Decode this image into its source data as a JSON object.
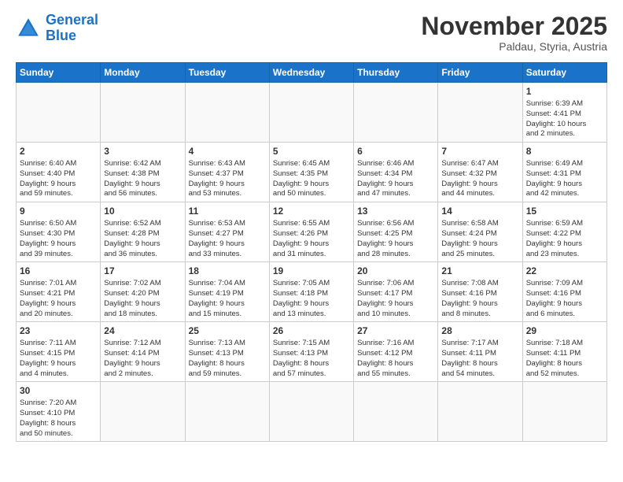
{
  "logo": {
    "line1": "General",
    "line2": "Blue"
  },
  "title": "November 2025",
  "subtitle": "Paldau, Styria, Austria",
  "weekdays": [
    "Sunday",
    "Monday",
    "Tuesday",
    "Wednesday",
    "Thursday",
    "Friday",
    "Saturday"
  ],
  "weeks": [
    [
      {
        "day": "",
        "info": ""
      },
      {
        "day": "",
        "info": ""
      },
      {
        "day": "",
        "info": ""
      },
      {
        "day": "",
        "info": ""
      },
      {
        "day": "",
        "info": ""
      },
      {
        "day": "",
        "info": ""
      },
      {
        "day": "1",
        "info": "Sunrise: 6:39 AM\nSunset: 4:41 PM\nDaylight: 10 hours\nand 2 minutes."
      }
    ],
    [
      {
        "day": "2",
        "info": "Sunrise: 6:40 AM\nSunset: 4:40 PM\nDaylight: 9 hours\nand 59 minutes."
      },
      {
        "day": "3",
        "info": "Sunrise: 6:42 AM\nSunset: 4:38 PM\nDaylight: 9 hours\nand 56 minutes."
      },
      {
        "day": "4",
        "info": "Sunrise: 6:43 AM\nSunset: 4:37 PM\nDaylight: 9 hours\nand 53 minutes."
      },
      {
        "day": "5",
        "info": "Sunrise: 6:45 AM\nSunset: 4:35 PM\nDaylight: 9 hours\nand 50 minutes."
      },
      {
        "day": "6",
        "info": "Sunrise: 6:46 AM\nSunset: 4:34 PM\nDaylight: 9 hours\nand 47 minutes."
      },
      {
        "day": "7",
        "info": "Sunrise: 6:47 AM\nSunset: 4:32 PM\nDaylight: 9 hours\nand 44 minutes."
      },
      {
        "day": "8",
        "info": "Sunrise: 6:49 AM\nSunset: 4:31 PM\nDaylight: 9 hours\nand 42 minutes."
      }
    ],
    [
      {
        "day": "9",
        "info": "Sunrise: 6:50 AM\nSunset: 4:30 PM\nDaylight: 9 hours\nand 39 minutes."
      },
      {
        "day": "10",
        "info": "Sunrise: 6:52 AM\nSunset: 4:28 PM\nDaylight: 9 hours\nand 36 minutes."
      },
      {
        "day": "11",
        "info": "Sunrise: 6:53 AM\nSunset: 4:27 PM\nDaylight: 9 hours\nand 33 minutes."
      },
      {
        "day": "12",
        "info": "Sunrise: 6:55 AM\nSunset: 4:26 PM\nDaylight: 9 hours\nand 31 minutes."
      },
      {
        "day": "13",
        "info": "Sunrise: 6:56 AM\nSunset: 4:25 PM\nDaylight: 9 hours\nand 28 minutes."
      },
      {
        "day": "14",
        "info": "Sunrise: 6:58 AM\nSunset: 4:24 PM\nDaylight: 9 hours\nand 25 minutes."
      },
      {
        "day": "15",
        "info": "Sunrise: 6:59 AM\nSunset: 4:22 PM\nDaylight: 9 hours\nand 23 minutes."
      }
    ],
    [
      {
        "day": "16",
        "info": "Sunrise: 7:01 AM\nSunset: 4:21 PM\nDaylight: 9 hours\nand 20 minutes."
      },
      {
        "day": "17",
        "info": "Sunrise: 7:02 AM\nSunset: 4:20 PM\nDaylight: 9 hours\nand 18 minutes."
      },
      {
        "day": "18",
        "info": "Sunrise: 7:04 AM\nSunset: 4:19 PM\nDaylight: 9 hours\nand 15 minutes."
      },
      {
        "day": "19",
        "info": "Sunrise: 7:05 AM\nSunset: 4:18 PM\nDaylight: 9 hours\nand 13 minutes."
      },
      {
        "day": "20",
        "info": "Sunrise: 7:06 AM\nSunset: 4:17 PM\nDaylight: 9 hours\nand 10 minutes."
      },
      {
        "day": "21",
        "info": "Sunrise: 7:08 AM\nSunset: 4:16 PM\nDaylight: 9 hours\nand 8 minutes."
      },
      {
        "day": "22",
        "info": "Sunrise: 7:09 AM\nSunset: 4:16 PM\nDaylight: 9 hours\nand 6 minutes."
      }
    ],
    [
      {
        "day": "23",
        "info": "Sunrise: 7:11 AM\nSunset: 4:15 PM\nDaylight: 9 hours\nand 4 minutes."
      },
      {
        "day": "24",
        "info": "Sunrise: 7:12 AM\nSunset: 4:14 PM\nDaylight: 9 hours\nand 2 minutes."
      },
      {
        "day": "25",
        "info": "Sunrise: 7:13 AM\nSunset: 4:13 PM\nDaylight: 8 hours\nand 59 minutes."
      },
      {
        "day": "26",
        "info": "Sunrise: 7:15 AM\nSunset: 4:13 PM\nDaylight: 8 hours\nand 57 minutes."
      },
      {
        "day": "27",
        "info": "Sunrise: 7:16 AM\nSunset: 4:12 PM\nDaylight: 8 hours\nand 55 minutes."
      },
      {
        "day": "28",
        "info": "Sunrise: 7:17 AM\nSunset: 4:11 PM\nDaylight: 8 hours\nand 54 minutes."
      },
      {
        "day": "29",
        "info": "Sunrise: 7:18 AM\nSunset: 4:11 PM\nDaylight: 8 hours\nand 52 minutes."
      }
    ],
    [
      {
        "day": "30",
        "info": "Sunrise: 7:20 AM\nSunset: 4:10 PM\nDaylight: 8 hours\nand 50 minutes."
      },
      {
        "day": "",
        "info": ""
      },
      {
        "day": "",
        "info": ""
      },
      {
        "day": "",
        "info": ""
      },
      {
        "day": "",
        "info": ""
      },
      {
        "day": "",
        "info": ""
      },
      {
        "day": "",
        "info": ""
      }
    ]
  ]
}
